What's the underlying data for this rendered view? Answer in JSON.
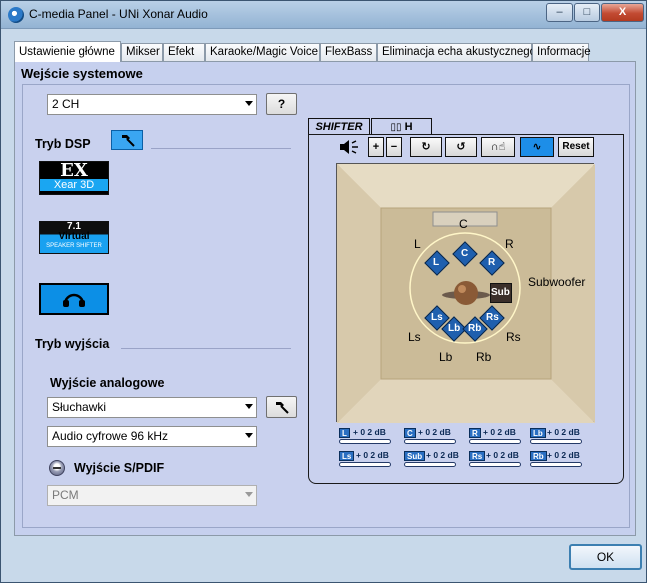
{
  "window": {
    "title": "C-media Panel - UNi Xonar Audio",
    "minimize": "–",
    "maximize": "□",
    "close": "X"
  },
  "tabs": [
    {
      "label": "Ustawienie główne",
      "active": true
    },
    {
      "label": "Mikser"
    },
    {
      "label": "Efekt"
    },
    {
      "label": "Karaoke/Magic Voice"
    },
    {
      "label": "FlexBass"
    },
    {
      "label": "Eliminacja echa akustycznego"
    },
    {
      "label": "Informacje"
    }
  ],
  "main": {
    "section_title": "Wejście systemowe",
    "channel_select": "2 CH",
    "help_button": "?",
    "dsp_mode_label": "Tryb DSP",
    "dsp_tiles": {
      "xear_top": "EX",
      "xear_bottom": "Xear 3D",
      "virtual_top": "7.1",
      "virtual_mid": "Virtual",
      "virtual_bottom": "SPEAKER SHIFTER"
    },
    "output_mode_label": "Tryb wyjścia",
    "analog_output_label": "Wyjście analogowe",
    "analog_output_select": "Słuchawki",
    "digital_format_select": "Audio cyfrowe 96 kHz",
    "spdif_label": "Wyjście S/PDIF",
    "spdif_select": "PCM"
  },
  "shifter": {
    "tab_shifter": "SHIFTER",
    "tab_h": "H",
    "reset": "Reset",
    "speakers": {
      "c": "C",
      "l": "L",
      "r": "R",
      "ls": "Ls",
      "rs": "Rs",
      "lb": "Lb",
      "rb": "Rb",
      "sub": "Subwoofer",
      "node_l": "L",
      "node_c": "C",
      "node_r": "R",
      "node_ls": "Ls",
      "node_lb": "Lb",
      "node_rb": "Rb",
      "node_rs": "Rs",
      "node_sub": "Sub"
    },
    "levels": [
      {
        "tag": "L",
        "value": "+ 0 2 dB"
      },
      {
        "tag": "C",
        "value": "+ 0 2 dB"
      },
      {
        "tag": "R",
        "value": "+ 0 2 dB"
      },
      {
        "tag": "Lb",
        "value": "+ 0 2 dB"
      },
      {
        "tag": "Ls",
        "value": "+ 0 2 dB"
      },
      {
        "tag": "Sub",
        "value": "+ 0 2 dB"
      },
      {
        "tag": "Rs",
        "value": "+ 0 2 dB"
      },
      {
        "tag": "Rb",
        "value": "+ 0 2 dB"
      }
    ]
  },
  "footer": {
    "ok": "OK"
  },
  "colors": {
    "accent_blue": "#1d8ee8",
    "panel": "#c6d0ee",
    "speaker_blue": "#1f5fae"
  }
}
